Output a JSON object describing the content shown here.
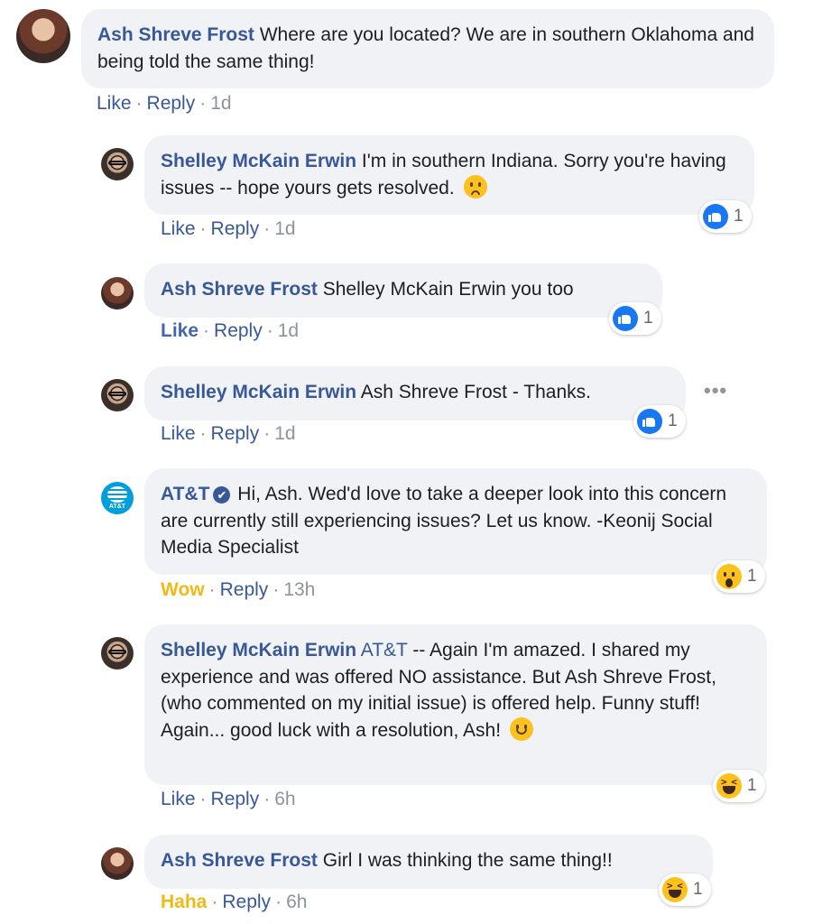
{
  "comments": [
    {
      "author": "Ash Shreve Frost",
      "text": "Where are you located? We are in southern Oklahoma and being told the same thing!",
      "like": "Like",
      "reply": "Reply",
      "time": "1d"
    },
    {
      "author": "Shelley McKain Erwin",
      "text": "I'm in southern Indiana. Sorry you're having issues -- hope yours gets resolved.",
      "emoji": "frowning-face-emoji",
      "like": "Like",
      "reply": "Reply",
      "time": "1d",
      "reaction": {
        "type": "like-icon",
        "count": "1"
      }
    },
    {
      "author": "Ash Shreve Frost",
      "mention": "Shelley McKain Erwin",
      "text": "you too",
      "like": "Like",
      "reply": "Reply",
      "time": "1d",
      "reaction": {
        "type": "like-icon",
        "count": "1"
      }
    },
    {
      "author": "Shelley McKain Erwin",
      "text": "Ash Shreve Frost - Thanks.",
      "like": "Like",
      "reply": "Reply",
      "time": "1d",
      "reaction": {
        "type": "like-icon",
        "count": "1"
      },
      "more": "•••"
    },
    {
      "author": "AT&T",
      "verified_mark": "✔",
      "text": "Hi, Ash. Wed'd love to take a deeper look into this concern are currently still experiencing issues? Let us know. -Keonij Social Media Specialist",
      "avatar_label": "AT&T",
      "like": "Wow",
      "reply": "Reply",
      "time": "13h",
      "reaction": {
        "type": "wow-icon",
        "count": "1"
      }
    },
    {
      "author": "Shelley McKain Erwin",
      "mention": "AT&T",
      "text": "-- Again I'm amazed. I shared my experience and was offered NO assistance. But Ash Shreve Frost, (who commented on my initial issue) is offered help. Funny stuff! Again... good luck with a resolution, Ash!",
      "emoji": "smiling-face-emoji",
      "like": "Like",
      "reply": "Reply",
      "time": "6h",
      "reaction": {
        "type": "haha-icon",
        "count": "1"
      }
    },
    {
      "author": "Ash Shreve Frost",
      "text": "Girl I was thinking the same thing!!",
      "like": "Haha",
      "reply": "Reply",
      "time": "6h",
      "reaction": {
        "type": "haha-icon",
        "count": "1"
      }
    }
  ],
  "separator": "·",
  "colors": {
    "author": "#385898",
    "bubble": "#f0f2f5",
    "meta": "#8d949e",
    "like_blue": "#1877f2",
    "reaction_yellow": "#f0ba15"
  }
}
